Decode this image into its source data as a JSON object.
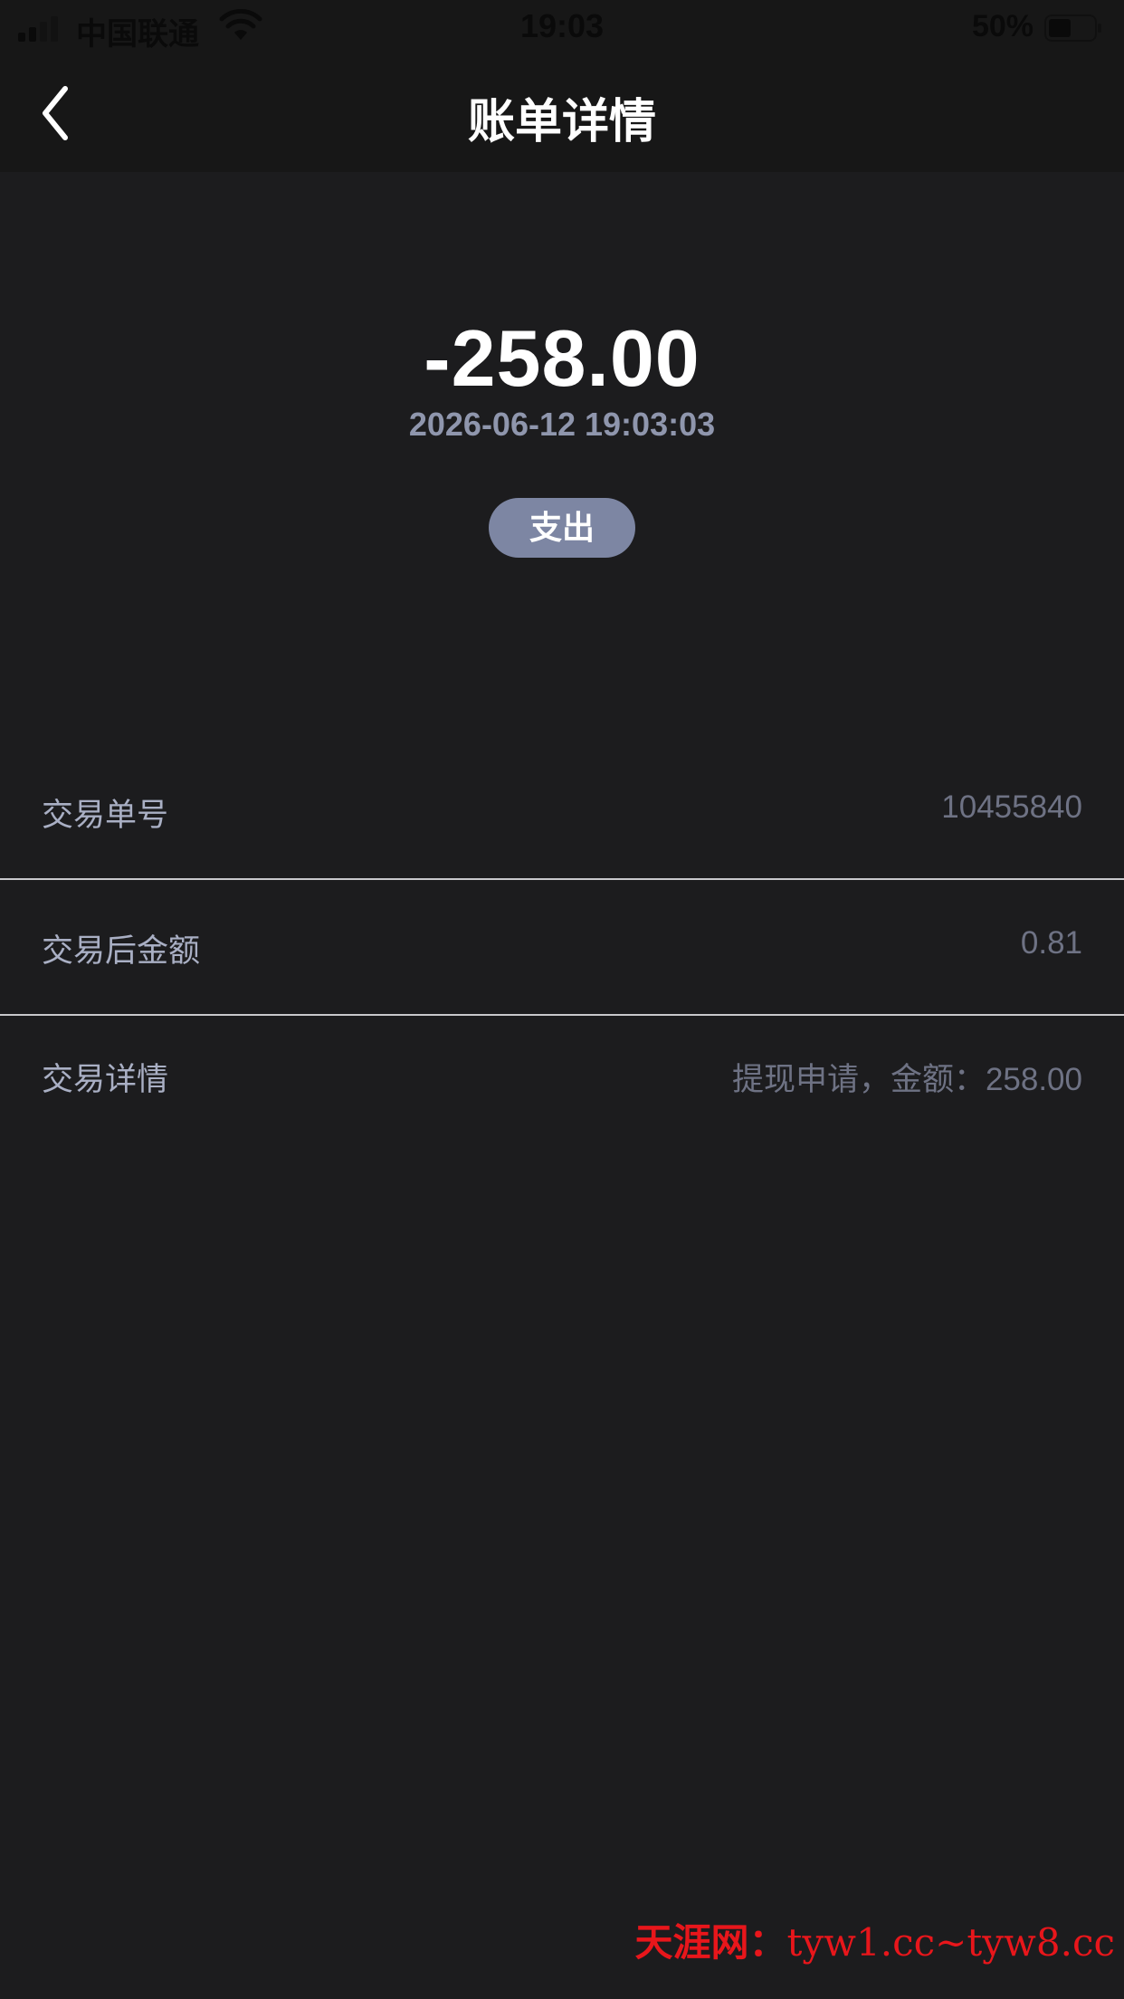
{
  "status_bar": {
    "carrier": "中国联通",
    "time": "19:03",
    "battery": "50%"
  },
  "nav": {
    "title": "账单详情",
    "back_icon": "chevron-left-icon"
  },
  "summary": {
    "amount": "-258.00",
    "datetime": "2026-06-12 19:03:03",
    "type": "支出"
  },
  "details": {
    "order_no": {
      "label": "交易单号",
      "value": "10455840"
    },
    "balance_after": {
      "label": "交易后金额",
      "value": "0.81"
    },
    "detail": {
      "label": "交易详情",
      "value": "提现申请，金额：258.00"
    }
  },
  "watermark": {
    "name": "天涯网：",
    "urls": "tyw1.cc~tyw8.cc"
  },
  "colors": {
    "background": "#1c1c1e",
    "header": "#171717",
    "badge": "#7d86a3",
    "watermark": "#e8161b"
  }
}
